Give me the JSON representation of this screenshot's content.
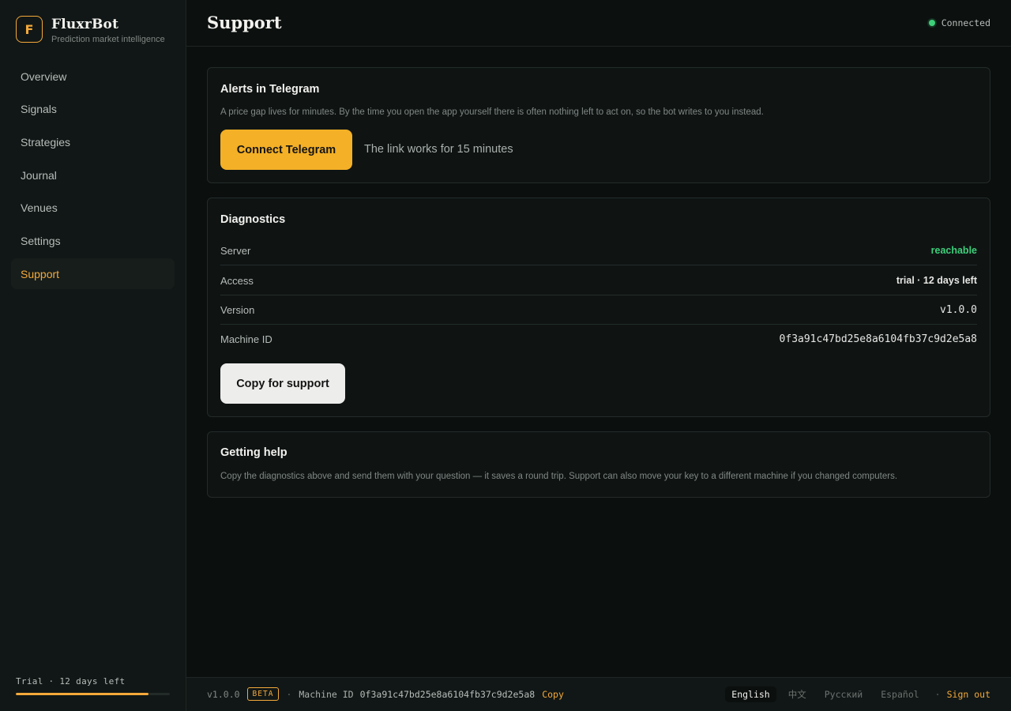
{
  "brand": {
    "logo_letter": "F",
    "name": "FluxrBot",
    "tagline": "Prediction market intelligence"
  },
  "sidebar": {
    "items": [
      {
        "label": "Overview"
      },
      {
        "label": "Signals"
      },
      {
        "label": "Strategies"
      },
      {
        "label": "Journal"
      },
      {
        "label": "Venues"
      },
      {
        "label": "Settings"
      },
      {
        "label": "Support",
        "active": true
      }
    ],
    "trial_label": "Trial · 12 days left",
    "trial_progress": 0.86
  },
  "header": {
    "title": "Support",
    "status": "Connected",
    "status_color": "#3ecf7a"
  },
  "telegram": {
    "title": "Alerts in Telegram",
    "desc": "A price gap lives for minutes. By the time you open the app yourself there is often nothing left to act on, so the bot writes to you instead.",
    "button": "Connect Telegram",
    "note": "The link works for 15 minutes"
  },
  "diagnostics": {
    "title": "Diagnostics",
    "rows": [
      {
        "key": "Server",
        "value": "reachable"
      },
      {
        "key": "Access",
        "value": "trial · 12 days left"
      },
      {
        "key": "Version",
        "value": "v1.0.0"
      },
      {
        "key": "Machine ID",
        "value": "0f3a91c47bd25e8a6104fb37c9d2e5a8"
      }
    ],
    "button": "Copy for support"
  },
  "help": {
    "title": "Getting help",
    "desc": "Copy the diagnostics above and send them with your question — it saves a round trip. Support can also move your key to a different machine if you changed computers."
  },
  "footer": {
    "version": "v1.0.0",
    "badge": "BETA",
    "separator": "·",
    "machine_label": "Machine ID",
    "machine_id": "0f3a91c47bd25e8a6104fb37c9d2e5a8",
    "copy": "Copy",
    "languages": [
      "English",
      "中文",
      "Русский",
      "Español"
    ],
    "active_language": "English",
    "sign_out": "Sign out"
  },
  "colors": {
    "accent": "#f4a93b",
    "success": "#3ecf7a",
    "background": "#0b0f0e"
  }
}
